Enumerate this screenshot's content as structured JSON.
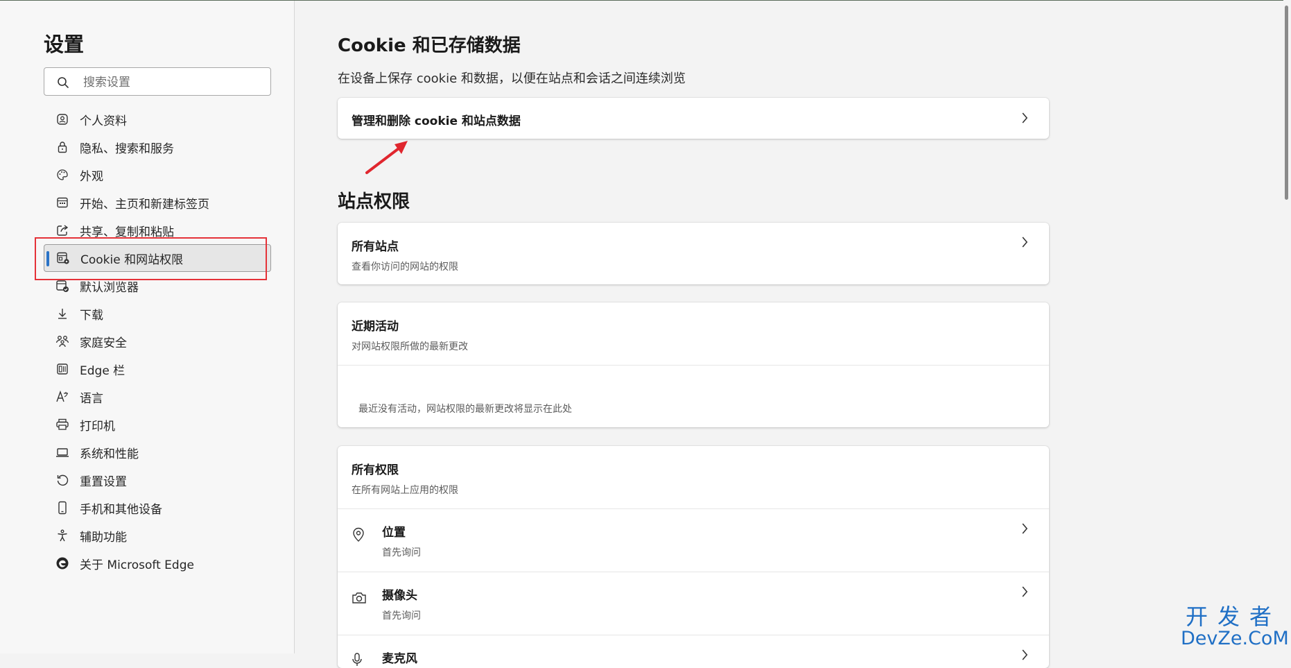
{
  "sidebar": {
    "title": "设置",
    "search_placeholder": "搜索设置",
    "items": [
      {
        "label": "个人资料",
        "icon": "profile-icon"
      },
      {
        "label": "隐私、搜索和服务",
        "icon": "lock-icon"
      },
      {
        "label": "外观",
        "icon": "palette-icon"
      },
      {
        "label": "开始、主页和新建标签页",
        "icon": "home-tab-icon"
      },
      {
        "label": "共享、复制和粘贴",
        "icon": "share-icon"
      },
      {
        "label": "Cookie 和网站权限",
        "icon": "cookie-permissions-icon",
        "active": true
      },
      {
        "label": "默认浏览器",
        "icon": "default-browser-icon"
      },
      {
        "label": "下载",
        "icon": "download-icon"
      },
      {
        "label": "家庭安全",
        "icon": "family-icon"
      },
      {
        "label": "Edge 栏",
        "icon": "edge-bar-icon"
      },
      {
        "label": "语言",
        "icon": "language-icon"
      },
      {
        "label": "打印机",
        "icon": "printer-icon"
      },
      {
        "label": "系统和性能",
        "icon": "laptop-icon"
      },
      {
        "label": "重置设置",
        "icon": "reset-icon"
      },
      {
        "label": "手机和其他设备",
        "icon": "phone-icon"
      },
      {
        "label": "辅助功能",
        "icon": "accessibility-icon"
      },
      {
        "label": "关于 Microsoft Edge",
        "icon": "edge-logo-icon"
      }
    ]
  },
  "main": {
    "cookies_title": "Cookie 和已存储数据",
    "cookies_desc": "在设备上保存 cookie 和数据，以便在站点和会话之间连续浏览",
    "manage_cookies_label": "管理和删除 cookie 和站点数据",
    "site_permissions_title": "站点权限",
    "all_sites": {
      "title": "所有站点",
      "subtitle": "查看你访问的网站的权限"
    },
    "recent_activity": {
      "title": "近期活动",
      "subtitle": "对网站权限所做的最新更改",
      "empty": "最近没有活动，网站权限的最新更改将显示在此处"
    },
    "all_permissions": {
      "title": "所有权限",
      "subtitle": "在所有网站上应用的权限",
      "items": [
        {
          "title": "位置",
          "subtitle": "首先询问",
          "icon": "location-icon"
        },
        {
          "title": "摄像头",
          "subtitle": "首先询问",
          "icon": "camera-icon"
        },
        {
          "title": "麦克风",
          "subtitle": "",
          "icon": "microphone-icon"
        }
      ]
    }
  },
  "watermark": {
    "top": "开发者",
    "bottom": "DevZe.CoM"
  },
  "colors": {
    "accent": "#2a73c7",
    "highlight_box": "#e53238",
    "annotation_arrow": "#e0262e",
    "watermark": "#1f6fc5"
  }
}
